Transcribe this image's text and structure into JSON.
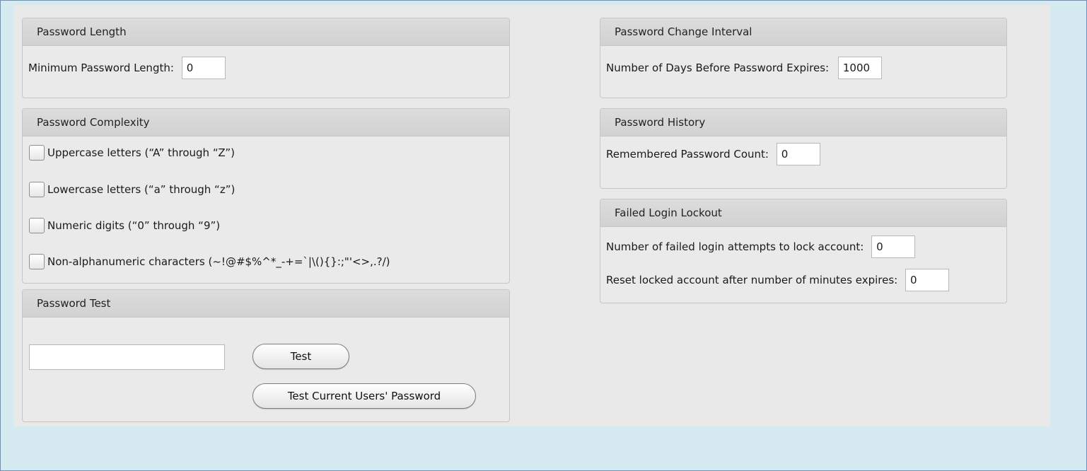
{
  "password_length": {
    "header": "Password Length",
    "min_label": "Minimum Password Length:",
    "min_value": "0"
  },
  "password_complexity": {
    "header": "Password Complexity",
    "options": [
      {
        "label": "Uppercase letters (“A” through “Z”)",
        "checked": false
      },
      {
        "label": "Lowercase letters (“a” through “z”)",
        "checked": false
      },
      {
        "label": "Numeric digits (“0” through “9”)",
        "checked": false
      },
      {
        "label": "Non-alphanumeric characters (~!@#$%^*_-+=`|\\(){}:;\"'<>,.?/)",
        "checked": false
      }
    ]
  },
  "password_test": {
    "header": "Password Test",
    "input_value": "",
    "test_button": "Test",
    "test_current_button": "Test Current Users' Password"
  },
  "password_change_interval": {
    "header": "Password Change Interval",
    "days_label": "Number of Days Before Password Expires:",
    "days_value": "1000"
  },
  "password_history": {
    "header": "Password History",
    "count_label": "Remembered Password Count:",
    "count_value": "0"
  },
  "failed_login_lockout": {
    "header": "Failed Login Lockout",
    "attempts_label": "Number of failed login attempts to lock account:",
    "attempts_value": "0",
    "reset_label": "Reset locked account after number of minutes expires:",
    "reset_value": "0"
  }
}
